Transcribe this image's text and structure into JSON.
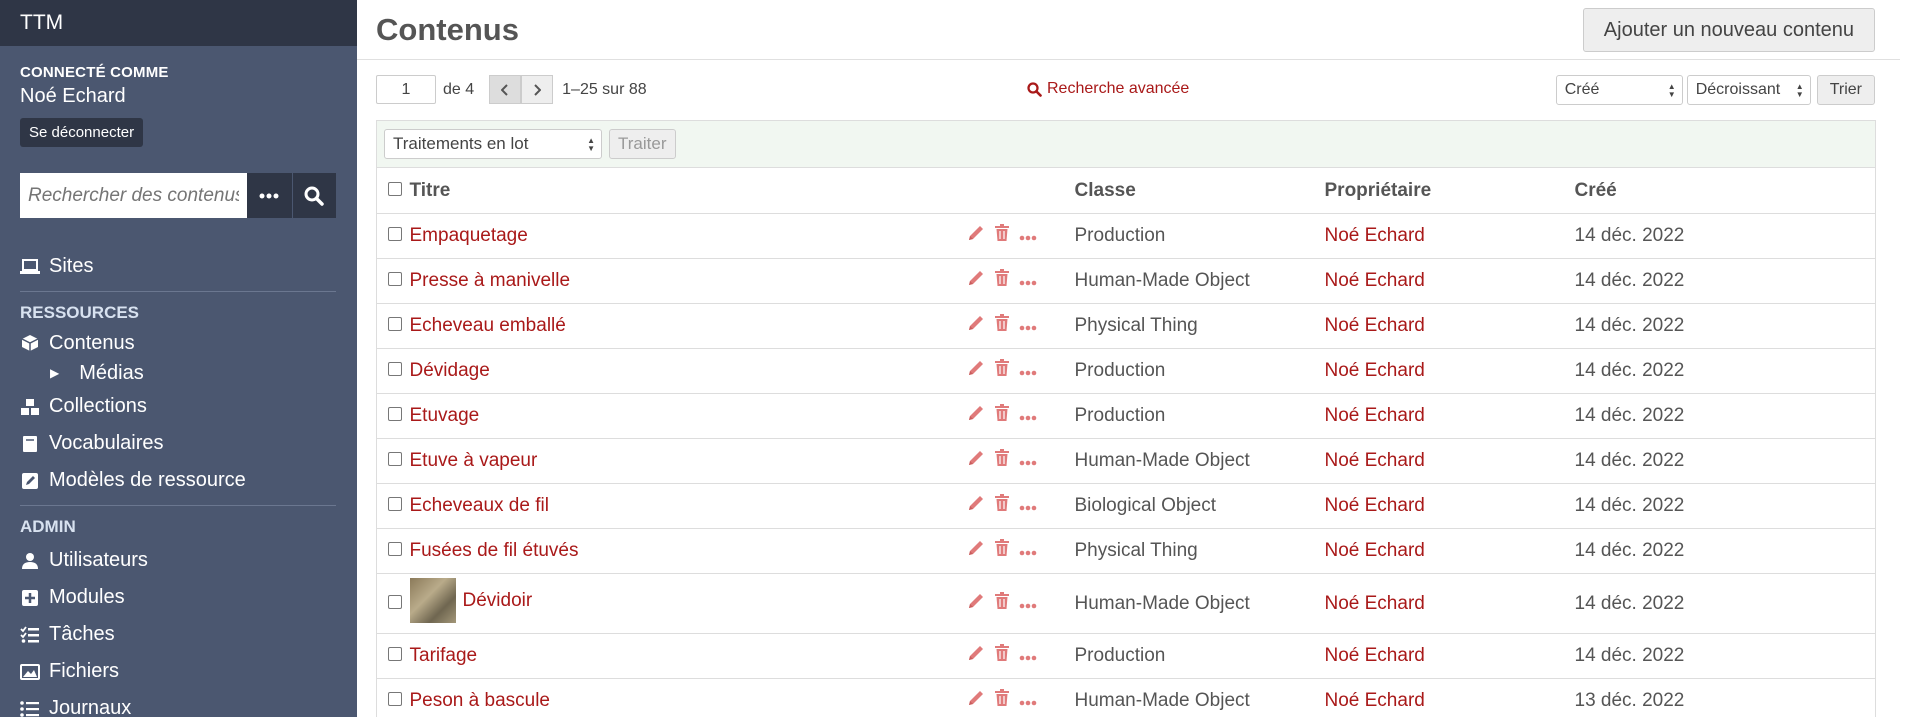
{
  "sidebar": {
    "site_title": "TTM",
    "connected_label": "Connecté comme",
    "username": "Noé Echard",
    "logout_label": "Se déconnecter",
    "search_placeholder": "Rechercher des contenus",
    "nav": {
      "sites": "Sites",
      "section_resources": "Ressources",
      "items": "Contenus",
      "media": "Médias",
      "collections": "Collections",
      "vocabularies": "Vocabulaires",
      "templates": "Modèles de ressource",
      "section_admin": "Admin",
      "users": "Utilisateurs",
      "modules": "Modules",
      "jobs": "Tâches",
      "assets": "Fichiers",
      "logs": "Journaux"
    }
  },
  "header": {
    "title": "Contenus",
    "add_button": "Ajouter un nouveau contenu"
  },
  "pagination": {
    "page": "1",
    "of": "de 4",
    "range": "1–25 sur 88"
  },
  "advanced_search": "Recherche avancée",
  "sorting": {
    "sort_by": "Créé",
    "order": "Décroissant",
    "sort_button": "Trier"
  },
  "batch": {
    "select_label": "Traitements en lot",
    "process_button": "Traiter"
  },
  "table": {
    "headers": {
      "title": "Titre",
      "class": "Classe",
      "owner": "Propriétaire",
      "created": "Créé"
    },
    "rows": [
      {
        "title": "Empaquetage",
        "class": "Production",
        "owner": "Noé Echard",
        "created": "14 déc. 2022"
      },
      {
        "title": "Presse à manivelle",
        "class": "Human-Made Object",
        "owner": "Noé Echard",
        "created": "14 déc. 2022"
      },
      {
        "title": "Echeveau emballé",
        "class": "Physical Thing",
        "owner": "Noé Echard",
        "created": "14 déc. 2022"
      },
      {
        "title": "Dévidage",
        "class": "Production",
        "owner": "Noé Echard",
        "created": "14 déc. 2022"
      },
      {
        "title": "Etuvage",
        "class": "Production",
        "owner": "Noé Echard",
        "created": "14 déc. 2022"
      },
      {
        "title": "Etuve à vapeur",
        "class": "Human-Made Object",
        "owner": "Noé Echard",
        "created": "14 déc. 2022"
      },
      {
        "title": "Echeveaux de fil",
        "class": "Biological Object",
        "owner": "Noé Echard",
        "created": "14 déc. 2022"
      },
      {
        "title": "Fusées de fil étuvés",
        "class": "Physical Thing",
        "owner": "Noé Echard",
        "created": "14 déc. 2022"
      },
      {
        "title": "Dévidoir",
        "class": "Human-Made Object",
        "owner": "Noé Echard",
        "created": "14 déc. 2022"
      },
      {
        "title": "Tarifage",
        "class": "Production",
        "owner": "Noé Echard",
        "created": "14 déc. 2022"
      },
      {
        "title": "Peson à bascule",
        "class": "Human-Made Object",
        "owner": "Noé Echard",
        "created": "13 déc. 2022"
      }
    ]
  },
  "colors": {
    "sidebar_bg": "#4b5770",
    "sidebar_dark": "#2f3646",
    "link_red": "#a91919",
    "action_icon": "#e07a7a"
  }
}
